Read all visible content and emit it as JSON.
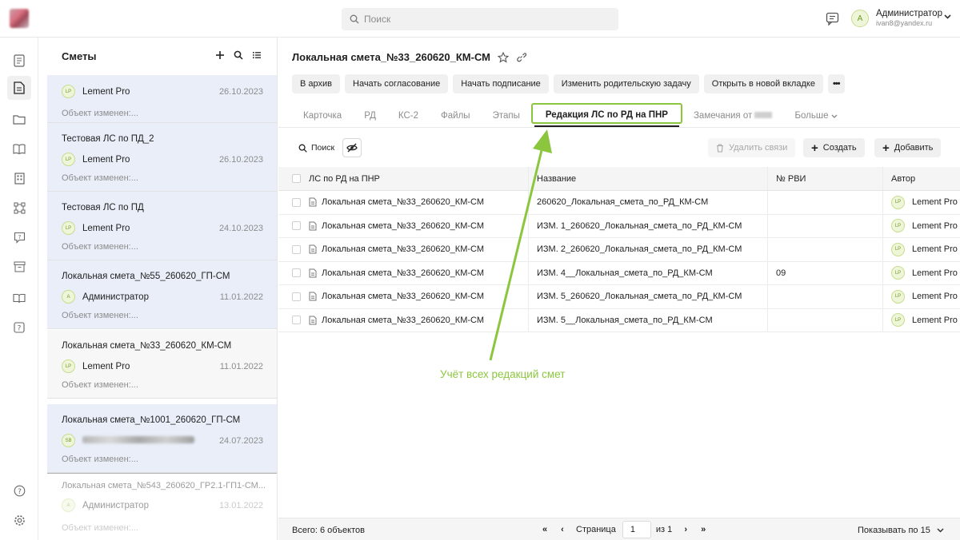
{
  "topbar": {
    "search_placeholder": "Поиск",
    "user_initial": "А",
    "user_name": "Администратор",
    "user_email": "ivan8@yandex.ru"
  },
  "sidebar_panel": {
    "title": "Сметы",
    "cards": [
      {
        "title": "",
        "initials": "LP",
        "author": "Lement Pro",
        "date": "26.10.2023",
        "changed": "Объект изменен:..."
      },
      {
        "title": "Тестовая ЛС по ПД_2",
        "initials": "LP",
        "author": "Lement Pro",
        "date": "26.10.2023",
        "changed": "Объект изменен:..."
      },
      {
        "title": "Тестовая ЛС по ПД",
        "initials": "LP",
        "author": "Lement Pro",
        "date": "24.10.2023",
        "changed": "Объект изменен:..."
      },
      {
        "title": "Локальная смета_№55_260620_ГП-СМ",
        "initials": "А",
        "author": "Администратор",
        "date": "11.01.2022",
        "changed": "Объект изменен:..."
      },
      {
        "title": "Локальная смета_№33_260620_КМ-СМ",
        "initials": "LP",
        "author": "Lement Pro",
        "date": "11.01.2022",
        "changed": "Объект изменен:..."
      },
      {
        "title": "Локальная смета_№1001_260620_ГП-СМ",
        "initials": "SB",
        "author": "",
        "date": "24.07.2023",
        "changed": "Объект изменен:..."
      },
      {
        "title": "Локальная смета_№543_260620_ГР2.1-ГП1-СМ...",
        "initials": "А",
        "author": "Администратор",
        "date": "13.01.2022",
        "changed": "Объект изменен:..."
      }
    ]
  },
  "doc": {
    "title": "Локальная смета_№33_260620_КМ-СМ",
    "actions": [
      "В архив",
      "Начать согласование",
      "Начать подписание",
      "Изменить родительскую задачу",
      "Открыть в новой вкладке"
    ],
    "more_label": "•••",
    "tabs": [
      "Карточка",
      "РД",
      "КС-2",
      "Файлы",
      "Этапы",
      "Редакция ЛС по РД на ПНР",
      "Замечания от",
      "Больше"
    ]
  },
  "toolbar": {
    "search_label": "Поиск",
    "delete_links": "Удалить связи",
    "create": "Создать",
    "add": "Добавить"
  },
  "table": {
    "headers": [
      "ЛС по РД на ПНР",
      "Название",
      "№ РВИ",
      "Автор"
    ],
    "rows": [
      {
        "ls": "Локальная смета_№33_260620_КМ-СМ",
        "name": "260620_Локальная_смета_по_РД_КМ-СМ",
        "rvi": "",
        "initials": "LP",
        "author": "Lement Pro"
      },
      {
        "ls": "Локальная смета_№33_260620_КМ-СМ",
        "name": "ИЗМ. 1_260620_Локальная_смета_по_РД_КМ-СМ",
        "rvi": "",
        "initials": "LP",
        "author": "Lement Pro"
      },
      {
        "ls": "Локальная смета_№33_260620_КМ-СМ",
        "name": "ИЗМ. 2_260620_Локальная_смета_по_РД_КМ-СМ",
        "rvi": "",
        "initials": "LP",
        "author": "Lement Pro"
      },
      {
        "ls": "Локальная смета_№33_260620_КМ-СМ",
        "name": "ИЗМ. 4__Локальная_смета_по_РД_КМ-СМ",
        "rvi": "09",
        "initials": "LP",
        "author": "Lement Pro"
      },
      {
        "ls": "Локальная смета_№33_260620_КМ-СМ",
        "name": "ИЗМ. 5_260620_Локальная_смета_по_РД_КМ-СМ",
        "rvi": "",
        "initials": "LP",
        "author": "Lement Pro"
      },
      {
        "ls": "Локальная смета_№33_260620_КМ-СМ",
        "name": "ИЗМ. 5__Локальная_смета_по_РД_КМ-СМ",
        "rvi": "",
        "initials": "LP",
        "author": "Lement Pro"
      }
    ]
  },
  "footer": {
    "total": "Всего: 6 объектов",
    "page_label": "Страница",
    "page_value": "1",
    "of_label": "из 1",
    "per_page": "Показывать по 15"
  },
  "annotation": "Учёт всех редакций смет",
  "colors": {
    "accent_green": "#8cc63f",
    "highlight_card": "#e9eef9"
  }
}
